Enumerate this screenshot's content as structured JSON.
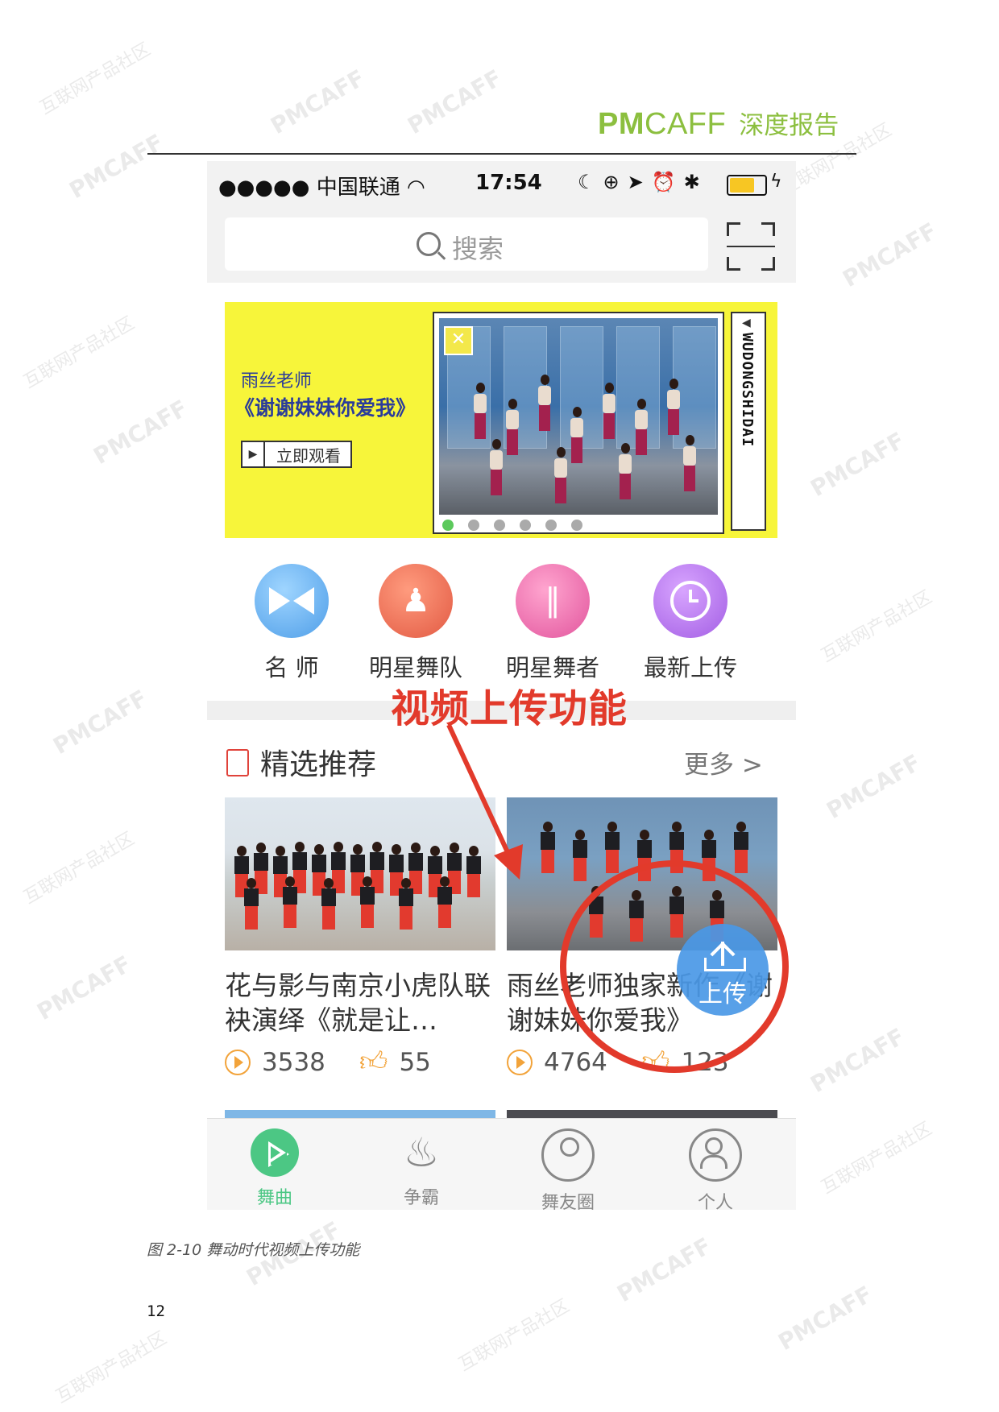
{
  "header": {
    "brand_pm": "PM",
    "brand_caff": "CAFF",
    "report_title": "深度报告"
  },
  "status_bar": {
    "carrier": "●●●●● 中国联通 ",
    "time": "17:54"
  },
  "search": {
    "placeholder": "搜索"
  },
  "banner": {
    "author": "雨丝老师",
    "title": "《谢谢妹妹你爱我》",
    "watch_label": "立即观看",
    "side_text": "WUDONGSHIDAI",
    "dots": 6,
    "active_dot": 0
  },
  "categories": [
    {
      "label": "名 师",
      "icon": "bowtie-icon"
    },
    {
      "label": "明星舞队",
      "icon": "team-icon"
    },
    {
      "label": "明星舞者",
      "icon": "ballet-shoes-icon"
    },
    {
      "label": "最新上传",
      "icon": "clock-icon"
    }
  ],
  "annotation": {
    "text": "视频上传功能",
    "color": "#e23a2b"
  },
  "section": {
    "title": "精选推荐",
    "more": "更多 >"
  },
  "videos": [
    {
      "title": "花与影与南京小虎队联袂演绎《就是让…",
      "plays": "3538",
      "likes": "55"
    },
    {
      "title": "雨丝老师独家新作《谢谢妹妹你爱我》",
      "plays": "4764",
      "likes": "123"
    }
  ],
  "upload_button": {
    "label": "上传",
    "icon": "upload-icon"
  },
  "tabbar": [
    {
      "label": "舞曲",
      "icon": "play-icon",
      "active": true
    },
    {
      "label": "争霸",
      "icon": "flame-icon",
      "active": false
    },
    {
      "label": "舞友圈",
      "icon": "eye-icon",
      "active": false
    },
    {
      "label": "个人",
      "icon": "person-icon",
      "active": false
    }
  ],
  "colors": {
    "brand_green": "#8cbf3f",
    "accent_green": "#4cc784",
    "banner_yellow": "#f7f53a",
    "annotation_red": "#e23a2b",
    "upload_blue": "#4a98e6"
  },
  "watermark": {
    "text_en": "PMCAFF",
    "text_cn": "互联网产品社区"
  },
  "caption": "图 2-10 舞动时代视频上传功能",
  "page_number": "12"
}
